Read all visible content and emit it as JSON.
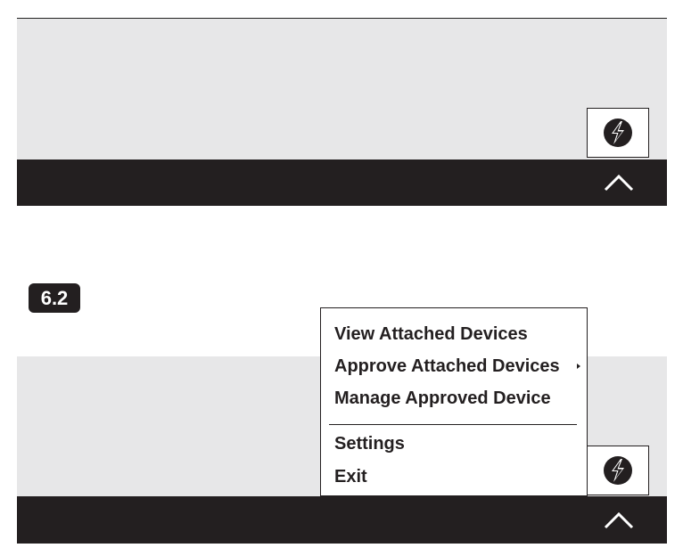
{
  "step_label": "6.2",
  "menu": {
    "items": [
      {
        "label": "View Attached Devices"
      },
      {
        "label": "Approve Attached Devices"
      },
      {
        "label": "Manage Approved Device"
      },
      {
        "label": "Settings"
      },
      {
        "label": "Exit"
      }
    ],
    "submenu_indicator_icon": "triangle-right-icon"
  },
  "icons": {
    "tray": "thunderbolt-icon",
    "taskbar_toggle": "chevron-up-icon"
  },
  "colors": {
    "taskbar": "#231f20",
    "desktop": "#e7e7e8",
    "menu_background": "#ffffff"
  }
}
